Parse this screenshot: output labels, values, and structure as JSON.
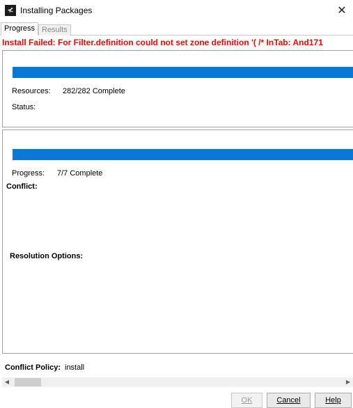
{
  "window": {
    "title": "Installing Packages",
    "app_icon": "≮",
    "close_glyph": "✕"
  },
  "tabs": [
    {
      "label": "Progress",
      "active": true
    },
    {
      "label": "Results",
      "active": false
    }
  ],
  "error_message": "Install Failed: For Filter.definition could not set zone definition '( /* InTab: And171",
  "resources_panel": {
    "progress_fraction": 1.0,
    "resources_label": "Resources:",
    "resources_value": "282/282 Complete",
    "status_label": "Status:"
  },
  "conflict_panel": {
    "progress_fraction": 1.0,
    "progress_label": "Progress:",
    "progress_value": "7/7 Complete",
    "conflict_label": "Conflict:",
    "resolution_label": "Resolution Options:"
  },
  "footer": {
    "policy_label": "Conflict Policy:",
    "policy_value": "install",
    "scroll_left": "◀",
    "scroll_right": "▶"
  },
  "buttons": {
    "ok": "OK",
    "cancel": "Cancel",
    "help": "Help"
  },
  "colors": {
    "progress_fill": "#0a78d7",
    "error_text": "#ff0000"
  }
}
